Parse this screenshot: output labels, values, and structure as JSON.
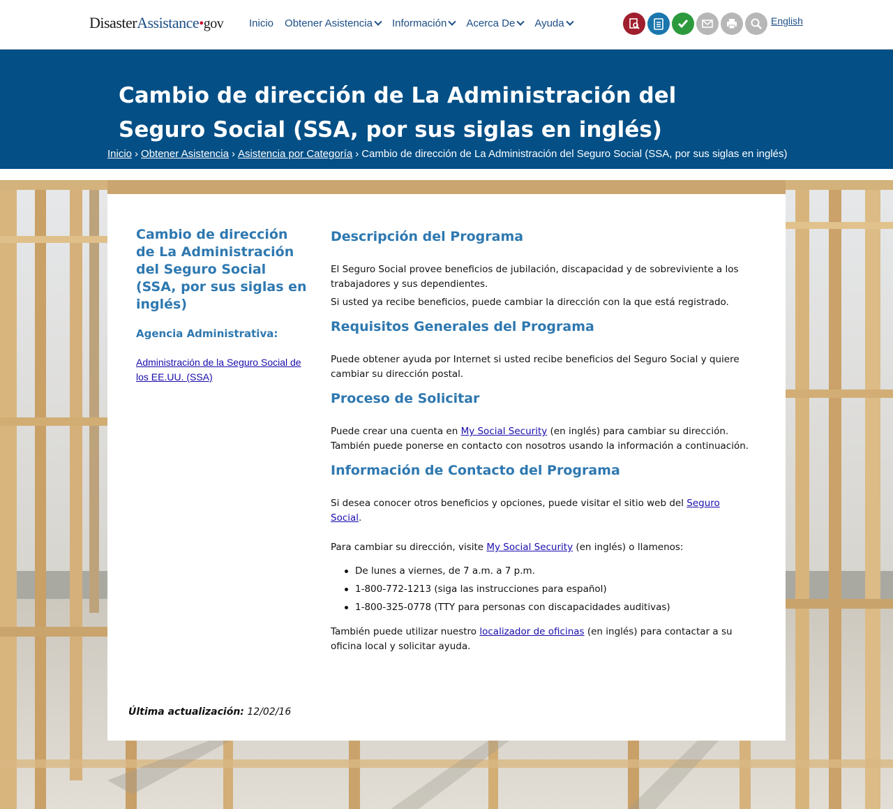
{
  "header": {
    "logo_part1": "Disaster",
    "logo_part2": "Assistance",
    "logo_dot": "•",
    "logo_part3": "gov",
    "nav": [
      "Inicio",
      "Obtener Asistencia",
      "Información",
      "Acerca De",
      "Ayuda"
    ],
    "tools": [
      {
        "icon": "search-document-icon",
        "color": "#a01f2e"
      },
      {
        "icon": "checklist-icon",
        "color": "#1a76ad"
      },
      {
        "icon": "check-icon",
        "color": "#2c9a3c"
      },
      {
        "icon": "email-icon",
        "color": "#b7b7b7"
      },
      {
        "icon": "print-icon",
        "color": "#b7b7b7"
      },
      {
        "icon": "search-icon",
        "color": "#b7b7b7"
      }
    ],
    "language_link": "English"
  },
  "band": {
    "title": "Cambio de dirección de La Administración del Seguro Social (SSA, por sus siglas en inglés)",
    "breadcrumbs": [
      "Inicio",
      "Obtener Asistencia",
      "Asistencia por Categoría"
    ],
    "breadcrumb_current": "Cambio de dirección de La Administración del Seguro Social (SSA, por sus siglas en inglés)",
    "separator": "›"
  },
  "sidebar": {
    "title": "Cambio de dirección de La Administración del Seguro Social (SSA, por sus siglas en inglés)",
    "agency_heading": "Agencia Administrativa:",
    "agency_link": "Administración de la Seguro Social de los EE.UU. (SSA)"
  },
  "main": {
    "desc_heading": "Descripción del Programa",
    "desc_p1": "El Seguro Social provee beneficios de jubilación, discapacidad y de sobreviviente a los trabajadores y sus dependientes.",
    "desc_p2": "Si usted ya recibe beneficios, puede cambiar la dirección con la que está registrado.",
    "req_heading": "Requisitos Generales del Programa",
    "req_p1": "Puede obtener ayuda por Internet si usted recibe beneficios del Seguro Social y quiere cambiar su dirección postal.",
    "proc_heading": "Proceso de Solicitar",
    "proc_p_before": "Puede crear una cuenta en ",
    "proc_link": "My Social Security",
    "proc_p_after": " (en inglés) para cambiar su dirección. También puede ponerse en contacto con nosotros usando la información a continuación.",
    "contact_heading": "Información de Contacto del Programa",
    "contact_p1_before": "Si desea conocer otros beneficios y opciones, puede visitar el sitio web del ",
    "contact_p1_link": "Seguro Social",
    "contact_p1_after": ".",
    "contact_p2_before": "Para cambiar su dirección, visite ",
    "contact_p2_link": "My Social Security",
    "contact_p2_after": " (en inglés) o llamenos:",
    "list": [
      "De lunes a viernes, de 7 a.m. a 7 p.m.",
      "1-800-772-1213 (siga las instrucciones para español)",
      "1-800-325-0778 (TTY para personas con discapacidades auditivas)"
    ],
    "contact_p3_before": "También puede utilizar nuestro ",
    "contact_p3_link": "localizador de oficinas",
    "contact_p3_after": " (en inglés) para contactar a su oficina local y solicitar ayuda."
  },
  "footer": {
    "updated_label": "Última actualización:",
    "updated_date": "12/02/16"
  }
}
